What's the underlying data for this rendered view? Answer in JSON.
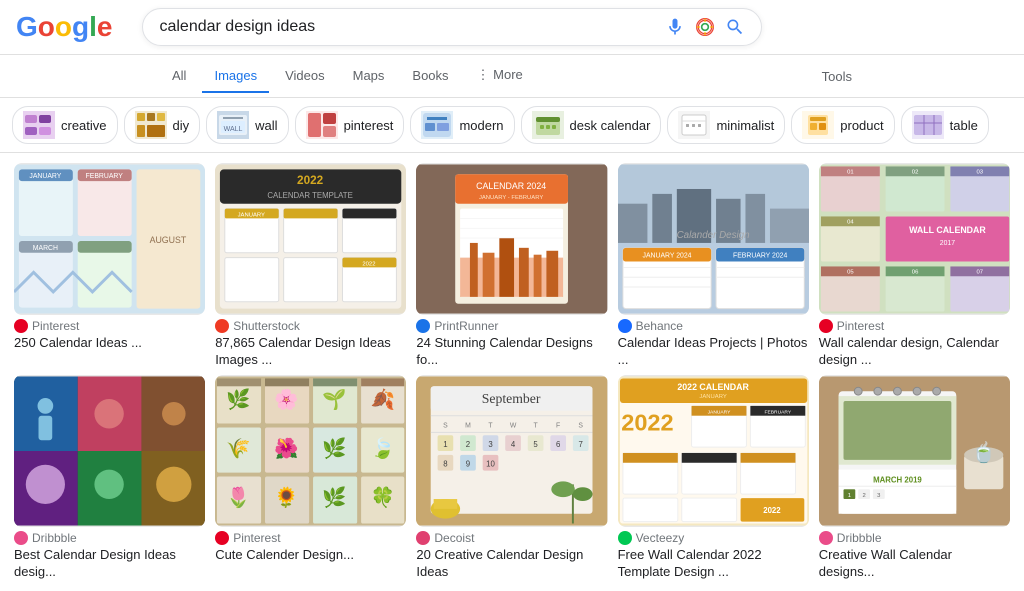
{
  "header": {
    "logo": "Google",
    "search_value": "calendar design ideas",
    "mic_label": "Search by voice",
    "lens_label": "Search by image",
    "search_label": "Search"
  },
  "nav": {
    "items": [
      {
        "label": "All",
        "active": false
      },
      {
        "label": "Images",
        "active": true
      },
      {
        "label": "Videos",
        "active": false
      },
      {
        "label": "Maps",
        "active": false
      },
      {
        "label": "Books",
        "active": false
      },
      {
        "label": "More",
        "active": false
      }
    ],
    "tools": "Tools"
  },
  "filters": [
    {
      "label": "creative",
      "color": "#f3c"
    },
    {
      "label": "diy",
      "color": "#adf"
    },
    {
      "label": "wall",
      "color": "#fca"
    },
    {
      "label": "pinterest",
      "color": "#e88"
    },
    {
      "label": "modern",
      "color": "#8cf"
    },
    {
      "label": "desk calendar",
      "color": "#af8"
    },
    {
      "label": "minimalist",
      "color": "#ccc"
    },
    {
      "label": "product",
      "color": "#fdb"
    },
    {
      "label": "table",
      "color": "#c8f"
    }
  ],
  "results_row1": [
    {
      "source": "Pinterest",
      "favicon_color": "#E60023",
      "caption": "250 Calendar Ideas ...",
      "bg": "#d8e8f0",
      "accent": "#f0a830"
    },
    {
      "source": "Shutterstock",
      "favicon_color": "#EF3B24",
      "caption": "87,865 Calendar Design Ideas Images ...",
      "bg": "#e8dcc8",
      "accent": "#d4a820"
    },
    {
      "source": "PrintRunner",
      "favicon_color": "#1a73e8",
      "caption": "24 Stunning Calendar Designs fo...",
      "bg": "#c8b090",
      "accent": "#e87830"
    },
    {
      "source": "Behance",
      "favicon_color": "#1769ff",
      "caption": "Calendar Ideas Projects | Photos ...",
      "bg": "#b8cce0",
      "accent": "#e89020"
    },
    {
      "source": "Pinterest",
      "favicon_color": "#E60023",
      "caption": "Wall calendar design, Calendar design ...",
      "bg": "#c8d8b0",
      "accent": "#e060a0"
    }
  ],
  "results_row2": [
    {
      "source": "Dribbble",
      "favicon_color": "#EA4C89",
      "caption": "Best Calendar Design Ideas desig...",
      "bg": "#3060a0",
      "accent": "#80c0e0"
    },
    {
      "source": "Pinterest",
      "favicon_color": "#E60023",
      "caption": "Cute Calender Design...",
      "bg": "#e8d8a0",
      "accent": "#80a860"
    },
    {
      "source": "Decoist",
      "favicon_color": "#e04070",
      "caption": "20 Creative Calendar Design Ideas",
      "bg": "#d8c8a0",
      "accent": "#e8c060"
    },
    {
      "source": "Vecteezy",
      "favicon_color": "#00c853",
      "caption": "Free Wall Calendar 2022 Template Design ...",
      "bg": "#f0e0c0",
      "accent": "#e0a020"
    },
    {
      "source": "Dribbble",
      "favicon_color": "#EA4C89",
      "caption": "Creative Wall Calendar designs...",
      "bg": "#d8c8b0",
      "accent": "#80a040"
    }
  ]
}
